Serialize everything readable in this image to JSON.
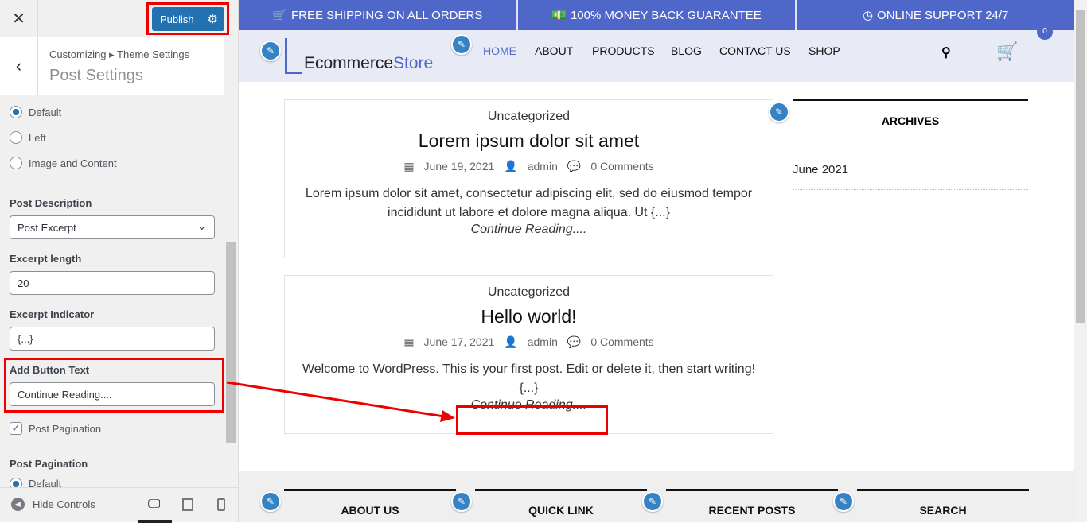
{
  "customizer": {
    "close_label": "✕",
    "publish_label": "Publish",
    "back_label": "‹",
    "breadcrumb": "Customizing ▸ Theme Settings",
    "title": "Post Settings",
    "layout_options": [
      {
        "label": "Default",
        "checked": true
      },
      {
        "label": "Left",
        "checked": false
      },
      {
        "label": "Image and Content",
        "checked": false
      }
    ],
    "post_description": {
      "label": "Post Description",
      "value": "Post Excerpt"
    },
    "excerpt_length": {
      "label": "Excerpt length",
      "value": "20"
    },
    "excerpt_indicator": {
      "label": "Excerpt Indicator",
      "value": "{...}"
    },
    "button_text": {
      "label": "Add Button Text",
      "value": "Continue Reading...."
    },
    "post_pagination_checkbox": {
      "label": "Post Pagination",
      "checked": true
    },
    "post_pagination": {
      "label": "Post Pagination",
      "option": "Default"
    },
    "hide_controls": "Hide Controls"
  },
  "preview": {
    "topbar": [
      "FREE SHIPPING ON ALL ORDERS",
      "100% MONEY BACK GUARANTEE",
      "ONLINE SUPPORT 24/7"
    ],
    "logo": {
      "part1": "Ecommerce",
      "part2": "Store"
    },
    "nav": [
      "HOME",
      "ABOUT",
      "PRODUCTS",
      "BLOG",
      "CONTACT US",
      "SHOP"
    ],
    "cart_count": "0",
    "posts": [
      {
        "category": "Uncategorized",
        "title": "Lorem ipsum dolor sit amet",
        "date": "June 19, 2021",
        "author": "admin",
        "comments": "0 Comments",
        "excerpt": "Lorem ipsum dolor sit amet, consectetur adipiscing elit, sed do eiusmod tempor incididunt ut labore et dolore magna aliqua. Ut {...}",
        "button": "Continue Reading...."
      },
      {
        "category": "Uncategorized",
        "title": "Hello world!",
        "date": "June 17, 2021",
        "author": "admin",
        "comments": "0 Comments",
        "excerpt": "Welcome to WordPress. This is your first post. Edit or delete it, then start writing! {...}",
        "button": "Continue Reading...."
      }
    ],
    "archives": {
      "title": "ARCHIVES",
      "items": [
        "June 2021"
      ]
    },
    "footer": [
      "ABOUT US",
      "QUICK LINK",
      "RECENT POSTS",
      "SEARCH"
    ]
  },
  "colors": {
    "accent": "#4f67c8",
    "publish": "#2271b1",
    "highlight": "#e00000"
  }
}
